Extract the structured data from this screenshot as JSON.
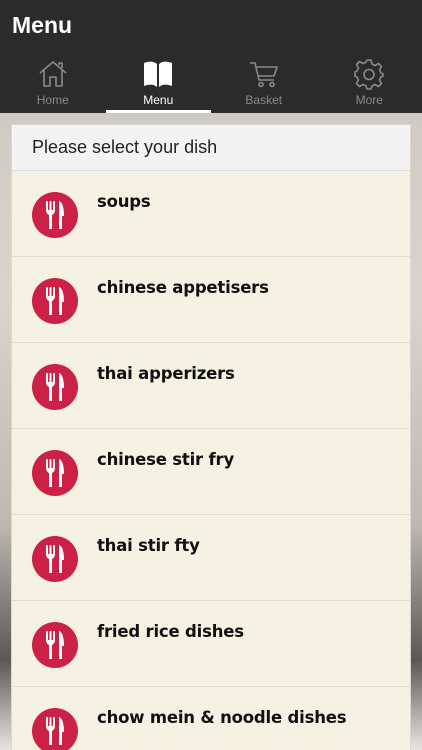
{
  "header": {
    "title": "Menu",
    "background": "#2b2b2b"
  },
  "tabs": [
    {
      "label": "Home",
      "icon": "home-icon",
      "active": false
    },
    {
      "label": "Menu",
      "icon": "book-icon",
      "active": true
    },
    {
      "label": "Basket",
      "icon": "cart-icon",
      "active": false
    },
    {
      "label": "More",
      "icon": "gear-icon",
      "active": false
    }
  ],
  "panel": {
    "heading": "Please select your dish",
    "items": [
      {
        "name": "soups",
        "icon": "fork-knife-icon"
      },
      {
        "name": "chinese appetisers",
        "icon": "fork-knife-icon"
      },
      {
        "name": "thai apperizers",
        "icon": "fork-knife-icon"
      },
      {
        "name": "chinese stir fry",
        "icon": "fork-knife-icon"
      },
      {
        "name": "thai stir fty",
        "icon": "fork-knife-icon"
      },
      {
        "name": "fried rice dishes",
        "icon": "fork-knife-icon"
      },
      {
        "name": "chow mein & noodle dishes",
        "icon": "fork-knife-icon"
      }
    ]
  },
  "colors": {
    "accent": "#cc2147",
    "panel_bg": "#f6f2e3",
    "tab_active": "#ffffff",
    "tab_inactive": "#8a8a8a"
  }
}
